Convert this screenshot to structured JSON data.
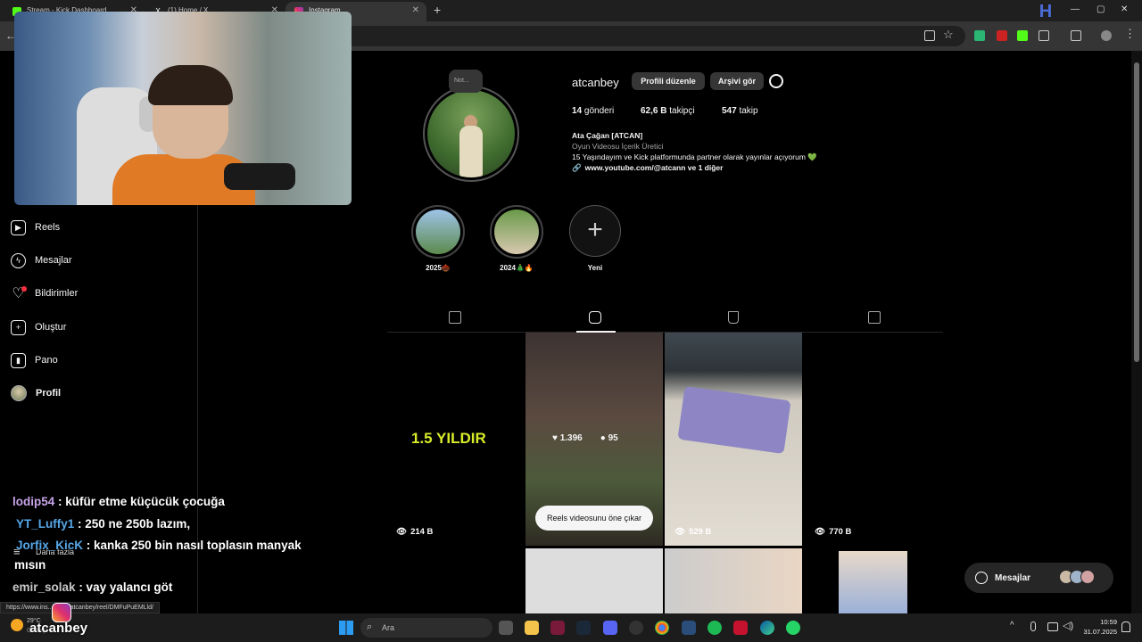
{
  "browser": {
    "tabs": [
      {
        "title": "Stream - Kick Dashboard",
        "color": "#53fc18"
      },
      {
        "title": "(1) Home / X",
        "color": "#ffffff"
      },
      {
        "title": "Instagram",
        "color": "#e1306c"
      }
    ],
    "new_tab": "+",
    "status_url": "https://www.ins... .com/atcanbey/reel/DMFuPuEMLld/"
  },
  "sidebar": {
    "items": [
      {
        "label": "Reels",
        "icon": "reels-icon"
      },
      {
        "label": "Mesajlar",
        "icon": "messenger-icon"
      },
      {
        "label": "Bildirimler",
        "icon": "heart-icon"
      },
      {
        "label": "Oluştur",
        "icon": "plus-square-icon"
      },
      {
        "label": "Pano",
        "icon": "chart-icon"
      },
      {
        "label": "Profil",
        "icon": "avatar"
      }
    ],
    "more": "Daha fazla"
  },
  "profile": {
    "note": "Not...",
    "username": "atcanbey",
    "edit_button": "Profili düzenle",
    "archive_button": "Arşivi gör",
    "posts_count": "14",
    "posts_label": "gönderi",
    "followers_count": "62,6 B",
    "followers_label": "takipçi",
    "following_count": "547",
    "following_label": "takip",
    "name": "Ata Çağan [ATCAN]",
    "category": "Oyun Videosu İçerik Üretici",
    "bio": "15 Yaşındayım ve Kick platformunda partner olarak yayınlar açıyorum 💚",
    "link": "www.youtube.com/@atcann ve 1 diğer"
  },
  "highlights": [
    {
      "label": "2025🌰"
    },
    {
      "label": "2024🎄🔥"
    },
    {
      "label": "Yeni"
    }
  ],
  "reels": {
    "tile1_text": "1.5 YILDIR",
    "tile1_views": "214 B",
    "tile2_likes": "1.396",
    "tile2_comments": "95",
    "tooltip": "Reels videosunu öne çıkar",
    "tile3_views": "529 B",
    "tile4_views": "770 B"
  },
  "chat": [
    {
      "user": "lodip54",
      "message": ": küfür etme küçücük çocuğa"
    },
    {
      "user": "YT_Luffy1",
      "message": ": 250 ne 250b lazım,"
    },
    {
      "user": "Jorfix_KicK",
      "message": ": kanka 250 bin nasıl toplasın manyak"
    },
    {
      "user": "",
      "message": "mısın"
    },
    {
      "user": "emir_solak",
      "message": ": vay yalancı göt"
    }
  ],
  "messages_pill": {
    "label": "Mesajlar"
  },
  "taskbar": {
    "search_placeholder": "Ara",
    "brand": "atcanbey",
    "weather_temp": "29°C",
    "weather_desc": "Güneşli",
    "time": "10:59",
    "date": "31.07.2025"
  }
}
